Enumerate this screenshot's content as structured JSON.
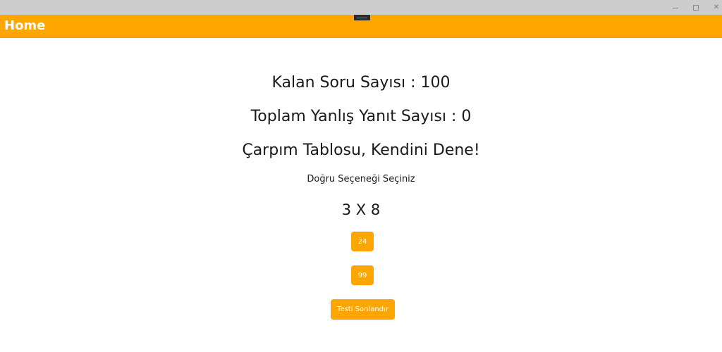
{
  "window": {
    "controls": {
      "minimize_icon": "minimize-icon",
      "maximize_icon": "maximize-icon",
      "close_icon": "close-icon",
      "close_glyph": "✕"
    }
  },
  "appbar": {
    "title": "Home",
    "color": "#ffa500"
  },
  "quiz": {
    "remaining_text": "Kalan Soru Sayısı : 100",
    "wrong_text": "Toplam Yanlış Yanıt Sayısı : 0",
    "heading": "Çarpım Tablosu, Kendini Dene!",
    "instruction": "Doğru Seçeneği Seçiniz",
    "question": "3 X 8",
    "options": [
      "24",
      "99"
    ],
    "end_button_label": "Testi Sonlandır"
  },
  "colors": {
    "accent": "#ffa500",
    "titlebar": "#cdcdcd",
    "text": "#1a1a1a"
  }
}
